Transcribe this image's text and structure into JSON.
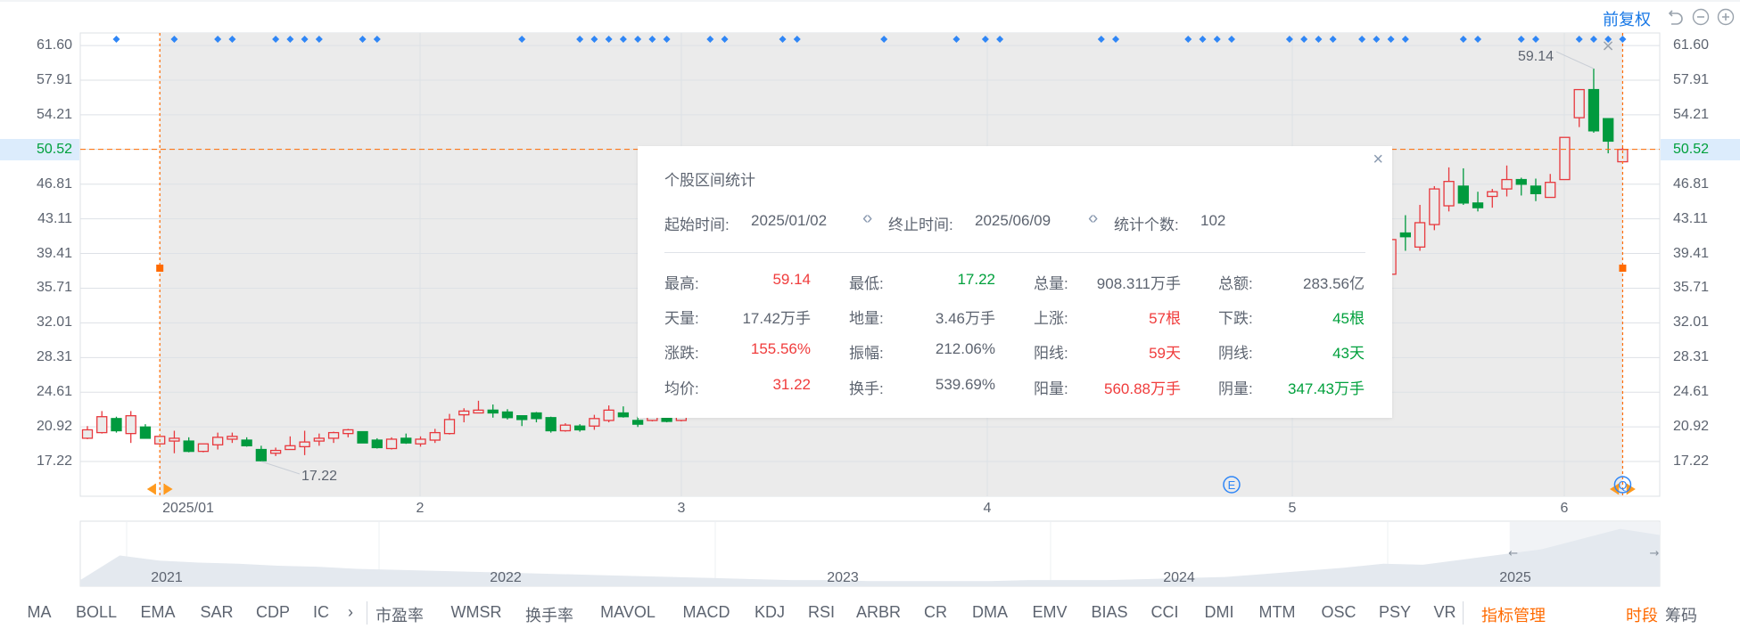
{
  "toolbar_top": {
    "adjust_label": "前复权",
    "icons": [
      "undo-icon",
      "zoom-out-icon",
      "zoom-in-icon"
    ]
  },
  "colors": {
    "up": "#e8383d",
    "down": "#009a3e",
    "accent": "#1677e6",
    "range_line": "#ff6a00",
    "marker": "#2f86f6"
  },
  "price_axis": {
    "ticks": [
      "61.60",
      "57.91",
      "54.21",
      "50.52",
      "46.81",
      "43.11",
      "39.41",
      "35.71",
      "32.01",
      "28.31",
      "24.61",
      "20.92",
      "17.22"
    ],
    "current_price": "50.52"
  },
  "time_axis": {
    "labels": [
      "2025/01",
      "2",
      "3",
      "4",
      "5",
      "6"
    ]
  },
  "chart_data": {
    "type": "candlestick",
    "ylim": [
      17.22,
      61.6
    ],
    "ohlc_note_fields": [
      "open",
      "high",
      "low",
      "close"
    ],
    "candles": [
      [
        19.7,
        21.0,
        19.6,
        20.6
      ],
      [
        20.3,
        22.6,
        20.2,
        22.0
      ],
      [
        21.8,
        22.0,
        20.3,
        20.5
      ],
      [
        20.2,
        22.6,
        19.2,
        22.1
      ],
      [
        20.9,
        21.2,
        19.7,
        19.7
      ],
      [
        19.1,
        19.9,
        19.1,
        19.9
      ],
      [
        19.4,
        20.5,
        18.1,
        19.7
      ],
      [
        19.4,
        19.8,
        18.2,
        18.3
      ],
      [
        18.3,
        19.1,
        18.2,
        19.1
      ],
      [
        19.0,
        20.3,
        18.5,
        19.8
      ],
      [
        19.6,
        20.3,
        19.2,
        19.9
      ],
      [
        19.5,
        19.8,
        18.8,
        18.9
      ],
      [
        18.5,
        18.9,
        17.22,
        17.3
      ],
      [
        18.1,
        18.7,
        17.8,
        18.4
      ],
      [
        18.5,
        19.9,
        18.5,
        18.9
      ],
      [
        18.8,
        20.5,
        17.9,
        19.3
      ],
      [
        19.4,
        20.2,
        18.9,
        19.7
      ],
      [
        19.7,
        20.4,
        19.2,
        20.3
      ],
      [
        20.2,
        20.7,
        19.8,
        20.6
      ],
      [
        20.4,
        20.4,
        19.2,
        19.2
      ],
      [
        19.5,
        19.7,
        18.6,
        18.7
      ],
      [
        18.6,
        19.8,
        18.5,
        19.6
      ],
      [
        19.7,
        20.2,
        19.1,
        19.2
      ],
      [
        19.1,
        19.9,
        18.8,
        19.6
      ],
      [
        19.5,
        20.7,
        19.2,
        20.3
      ],
      [
        20.2,
        22.3,
        20.1,
        21.7
      ],
      [
        22.2,
        22.9,
        21.4,
        22.6
      ],
      [
        22.4,
        23.7,
        22.4,
        22.7
      ],
      [
        22.7,
        23.3,
        21.9,
        22.4
      ],
      [
        22.5,
        22.8,
        21.7,
        21.9
      ],
      [
        22.1,
        22.1,
        21.0,
        21.7
      ],
      [
        22.4,
        22.5,
        21.4,
        21.8
      ],
      [
        21.9,
        22.0,
        20.3,
        20.5
      ],
      [
        20.5,
        21.3,
        20.4,
        21.1
      ],
      [
        21.0,
        21.2,
        20.4,
        20.6
      ],
      [
        21.0,
        22.2,
        20.6,
        21.8
      ],
      [
        21.6,
        23.2,
        21.4,
        22.7
      ],
      [
        22.4,
        23.1,
        21.9,
        22.0
      ],
      [
        21.6,
        22.0,
        20.9,
        21.2
      ],
      [
        21.6,
        22.3,
        21.5,
        22.2
      ],
      [
        22.0,
        22.3,
        21.4,
        21.5
      ],
      [
        21.6,
        22.5,
        21.5,
        22.3
      ],
      null,
      null,
      null,
      null,
      null,
      null,
      null,
      null,
      null,
      null,
      null,
      null,
      null,
      null,
      null,
      null,
      null,
      null,
      null,
      null,
      null,
      null,
      null,
      null,
      null,
      null,
      null,
      null,
      null,
      null,
      null,
      null,
      null,
      null,
      null,
      null,
      null,
      null,
      null,
      null,
      null,
      null,
      null,
      null,
      null,
      null,
      null,
      null,
      [
        37.2,
        41.2,
        37.0,
        40.9
      ],
      [
        41.6,
        43.5,
        39.7,
        41.2
      ],
      [
        40.1,
        44.6,
        39.7,
        42.7
      ],
      [
        42.5,
        46.6,
        41.9,
        46.3
      ],
      [
        44.5,
        48.6,
        43.9,
        47.1
      ],
      [
        46.6,
        48.5,
        44.6,
        44.8
      ],
      [
        44.8,
        46.0,
        43.9,
        44.3
      ],
      [
        45.5,
        46.3,
        44.3,
        46.0
      ],
      [
        46.3,
        48.8,
        45.5,
        47.3
      ],
      [
        47.3,
        47.5,
        45.6,
        46.8
      ],
      [
        46.6,
        47.4,
        45.0,
        45.8
      ],
      [
        45.4,
        47.9,
        45.4,
        47.0
      ],
      [
        47.3,
        51.8,
        47.3,
        51.8
      ],
      [
        53.9,
        56.9,
        52.9,
        56.9
      ],
      [
        56.9,
        59.14,
        52.3,
        52.5
      ],
      [
        53.8,
        53.8,
        50.1,
        51.4
      ],
      [
        49.2,
        50.7,
        49.2,
        50.52
      ]
    ],
    "range_start_index": 5,
    "range_end_index": 106,
    "high_label": "59.14",
    "high_index": 104,
    "low_label": "17.22",
    "low_index": 12,
    "event_marker_indices": [
      2,
      6,
      9,
      10,
      13,
      14,
      15,
      16,
      19,
      20,
      30,
      34,
      35,
      36,
      37,
      38,
      39,
      40,
      43,
      44,
      48,
      49,
      55,
      60,
      62,
      63,
      70,
      71,
      76,
      77,
      78,
      79,
      83,
      84,
      85,
      86,
      88,
      89,
      90,
      91,
      95,
      96,
      99,
      100,
      103,
      104,
      105,
      106
    ],
    "badges": [
      {
        "letter": "E",
        "index": 79
      },
      {
        "letter": "Q",
        "index": 106
      }
    ]
  },
  "navigator": {
    "year_labels": [
      "2021",
      "2022",
      "2023",
      "2024",
      "2025"
    ],
    "series": [
      6,
      30,
      25,
      23,
      22,
      20,
      19,
      17,
      16,
      15,
      14,
      13,
      12,
      11,
      10,
      9,
      8,
      7,
      6,
      6,
      5,
      5,
      5,
      5,
      6,
      6,
      6,
      7,
      8,
      9,
      12,
      15,
      18,
      22,
      21,
      26,
      31,
      36,
      46,
      56,
      50
    ],
    "window_start": 0.905,
    "window_end": 1.0
  },
  "popup": {
    "title": "个股区间统计",
    "start_label": "起始时间:",
    "start_value": "2025/01/02",
    "end_label": "终止时间:",
    "end_value": "2025/06/09",
    "count_label": "统计个数:",
    "count_value": "102",
    "close": "×",
    "stats": [
      [
        {
          "label": "最高:",
          "value": "59.14",
          "color": "#f03c3c"
        },
        {
          "label": "最低:",
          "value": "17.22",
          "color": "#00a03c"
        },
        {
          "label": "总量:",
          "value": "908.311万手",
          "color": "#5d6470"
        },
        {
          "label": "总额:",
          "value": "283.56亿",
          "color": "#5d6470"
        }
      ],
      [
        {
          "label": "天量:",
          "value": "17.42万手",
          "color": "#5d6470"
        },
        {
          "label": "地量:",
          "value": "3.46万手",
          "color": "#5d6470"
        },
        {
          "label": "上涨:",
          "value": "57根",
          "color": "#f03c3c"
        },
        {
          "label": "下跌:",
          "value": "45根",
          "color": "#00a03c"
        }
      ],
      [
        {
          "label": "涨跌:",
          "value": "155.56%",
          "color": "#f03c3c"
        },
        {
          "label": "振幅:",
          "value": "212.06%",
          "color": "#5d6470"
        },
        {
          "label": "阳线:",
          "value": "59天",
          "color": "#f03c3c"
        },
        {
          "label": "阴线:",
          "value": "43天",
          "color": "#00a03c"
        }
      ],
      [
        {
          "label": "均价:",
          "value": "31.22",
          "color": "#f03c3c"
        },
        {
          "label": "换手:",
          "value": "539.69%",
          "color": "#5d6470"
        },
        {
          "label": "阳量:",
          "value": "560.88万手",
          "color": "#f03c3c"
        },
        {
          "label": "阴量:",
          "value": "347.43万手",
          "color": "#00a03c"
        }
      ]
    ]
  },
  "indicators": {
    "items": [
      "MA",
      "BOLL",
      "EMA",
      "SAR",
      "CDP",
      "IC",
      "市盈率",
      "WMSR",
      "换手率",
      "MAVOL",
      "MACD",
      "KDJ",
      "RSI",
      "ARBR",
      "CR",
      "DMA",
      "EMV",
      "BIAS",
      "CCI",
      "DMI",
      "MTM",
      "OSC",
      "PSY",
      "VR"
    ],
    "more": "›",
    "manage": "指标管理",
    "period": "时段",
    "chips": "筹码"
  }
}
